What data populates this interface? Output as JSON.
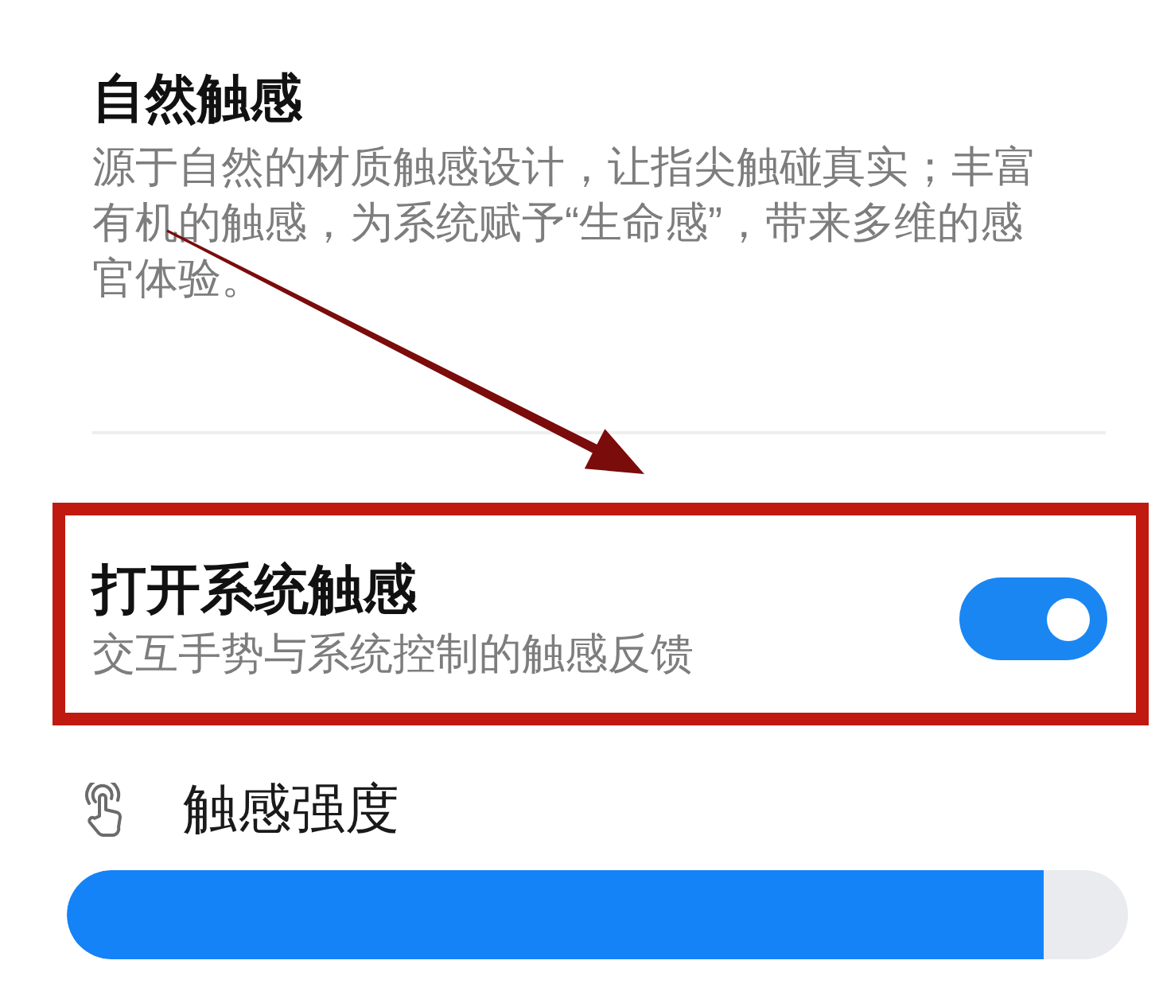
{
  "section": {
    "title": "自然触感",
    "description": "源于自然的材质触感设计，让指尖触碰真实；丰富有机的触感，为系统赋予“生命感”，带来多维的感官体验。"
  },
  "toggle_setting": {
    "title": "打开系统触感",
    "subtitle": "交互手势与系统控制的触感反馈",
    "on": true,
    "highlighted": true
  },
  "intensity": {
    "label": "触感强度",
    "level": 0.92
  },
  "annotations": [
    {
      "kind": "arrow"
    }
  ]
}
